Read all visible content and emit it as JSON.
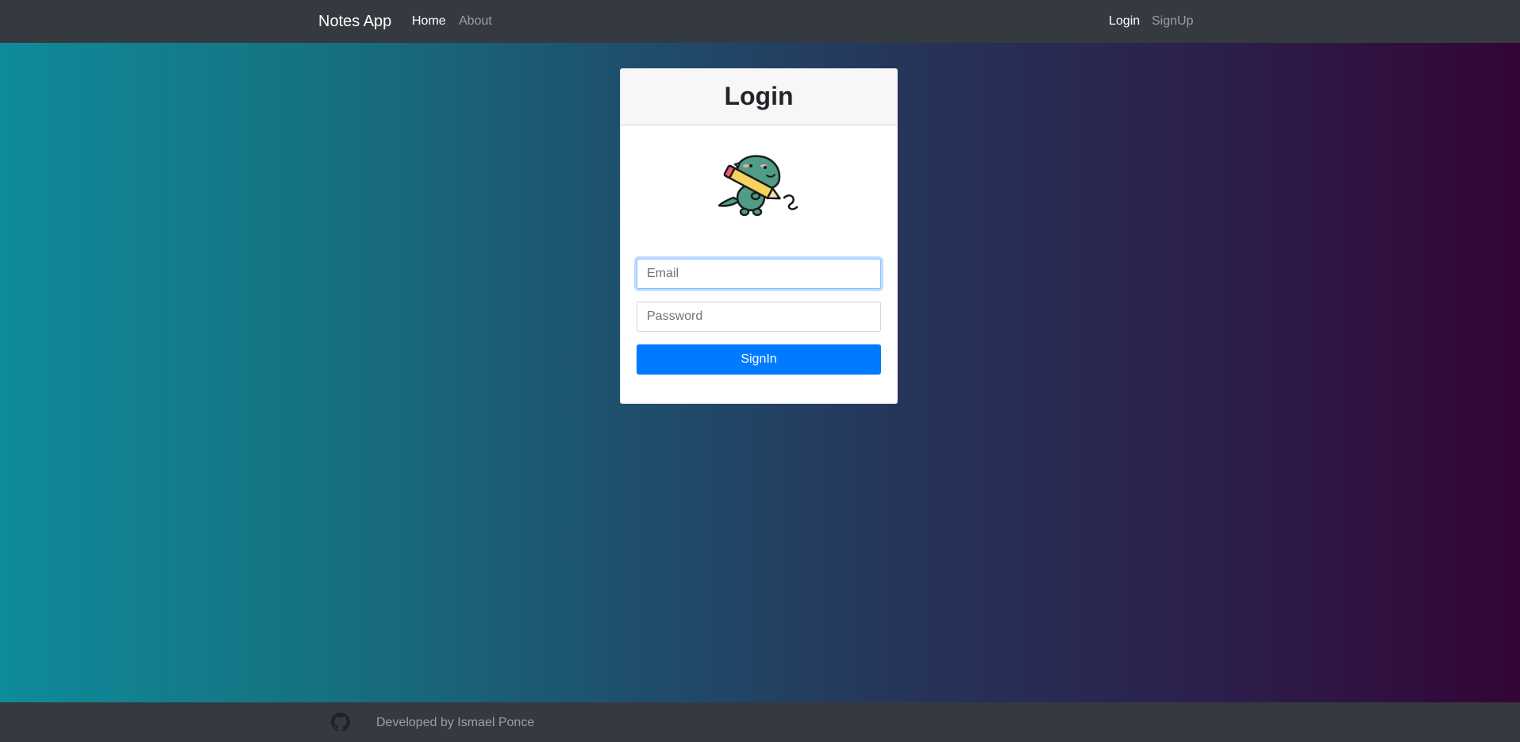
{
  "navbar": {
    "brand": "Notes App",
    "left_links": [
      {
        "label": "Home",
        "active": true
      },
      {
        "label": "About",
        "active": false
      }
    ],
    "right_links": [
      {
        "label": "Login",
        "active": true
      },
      {
        "label": "SignUp",
        "active": false
      }
    ]
  },
  "login_card": {
    "title": "Login",
    "logo_icon": "dinosaur-with-pencil",
    "email_placeholder": "Email",
    "email_value": "",
    "password_placeholder": "Password",
    "password_value": "",
    "submit_label": "SignIn"
  },
  "footer": {
    "icon": "github-icon",
    "text": "Developed by Ismael Ponce"
  },
  "colors": {
    "navbar_bg": "#343a40",
    "primary": "#007bff",
    "gradient_start": "#0f8b9a",
    "gradient_end": "#330536"
  }
}
